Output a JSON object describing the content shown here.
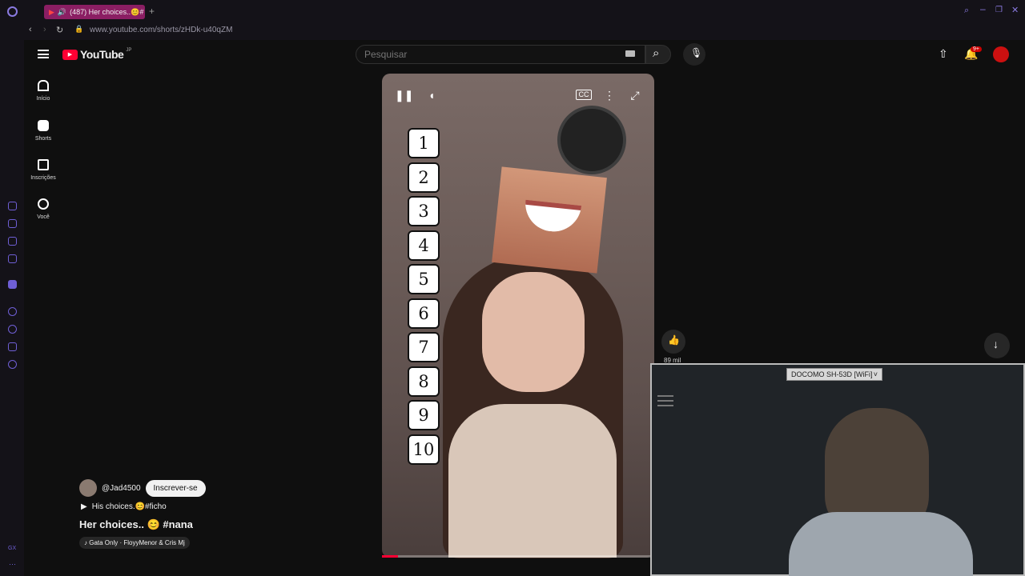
{
  "browser": {
    "tab_title": "(487) Her choices..😊#",
    "url": "www.youtube.com/shorts/zHDk-u40qZM"
  },
  "header": {
    "logo_text": "YouTube",
    "logo_region": "JP",
    "search_placeholder": "Pesquisar",
    "notification_badge": "9+"
  },
  "nav": {
    "items": [
      {
        "label": "Início",
        "icon": "home-icon"
      },
      {
        "label": "Shorts",
        "icon": "shorts-icon"
      },
      {
        "label": "Inscrições",
        "icon": "subscriptions-icon"
      },
      {
        "label": "Você",
        "icon": "you-icon"
      }
    ]
  },
  "video": {
    "rank_numbers": [
      "1",
      "2",
      "3",
      "4",
      "5",
      "6",
      "7",
      "8",
      "9",
      "10"
    ],
    "progress": 0.06
  },
  "channel": {
    "handle": "@Jad4500",
    "subscribe_label": "Inscrever-se"
  },
  "short": {
    "description": "His choices.😊#ficho",
    "title": "Her choices.. 😊 #nana",
    "music": "Gata Only · FloyyMenor & Cris Mj"
  },
  "actions": {
    "like_count": "89 mil"
  },
  "webcam": {
    "wifi_label": "DOCOMO SH-53D [WiFi]"
  },
  "colors": {
    "accent_red": "#ff0033",
    "tab_pink": "#8b1e63",
    "gx_purple": "#6f5fd6"
  }
}
